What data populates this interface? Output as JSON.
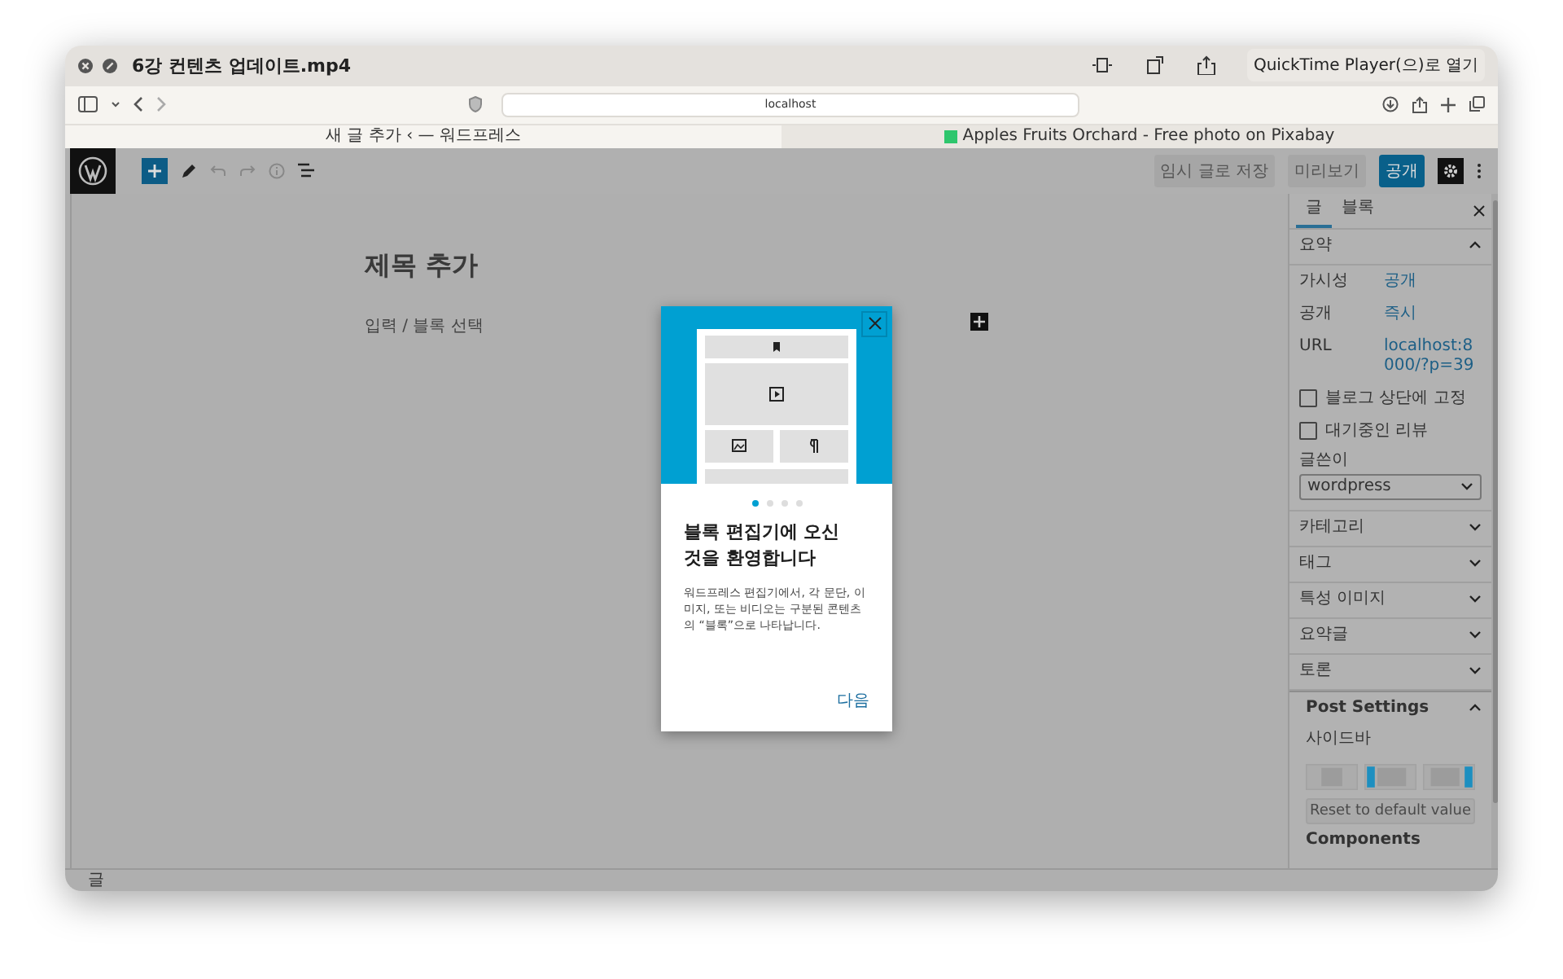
{
  "video_window": {
    "title": "6강 컨텐츠 업데이트.mp4",
    "open_button": "QuickTime Player(으)로 열기"
  },
  "browser": {
    "address": "localhost",
    "tabs": [
      {
        "label": "새 글 추가 ‹ — 워드프레스",
        "selected": true
      },
      {
        "label": "Apples Fruits Orchard - Free photo on Pixabay",
        "selected": false
      }
    ]
  },
  "editor_toolbar": {
    "buttons": [
      {
        "kind": "secondary",
        "label": "임시 글로 저장"
      },
      {
        "kind": "secondary",
        "label": "미리보기"
      },
      {
        "kind": "primary",
        "label": "공개"
      }
    ]
  },
  "editor": {
    "title_placeholder": "제목 추가",
    "block_placeholder": "입력 / 블록 선택"
  },
  "sidebar": {
    "tabs": [
      {
        "label": "글",
        "selected": true
      },
      {
        "label": "블록",
        "selected": false
      }
    ],
    "summary": {
      "title": "요약",
      "expanded": true,
      "fields": [
        {
          "label": "가시성",
          "value": "공개"
        },
        {
          "label": "공개",
          "value": "즉시"
        },
        {
          "label": "URL",
          "value": "localhost:8000/?p=39"
        }
      ],
      "checkboxes": [
        {
          "label": "블로그 상단에 고정",
          "checked": false
        },
        {
          "label": "대기중인 리뷰",
          "checked": false
        }
      ],
      "author": {
        "label": "글쓴이",
        "value": "wordpress"
      }
    },
    "panels": [
      {
        "title": "카테고리",
        "expanded": false
      },
      {
        "title": "태그",
        "expanded": false
      },
      {
        "title": "특성 이미지",
        "expanded": false
      },
      {
        "title": "요약글",
        "expanded": false
      },
      {
        "title": "토론",
        "expanded": false
      }
    ],
    "post_settings": {
      "title": "Post Settings",
      "expanded": true,
      "sidebar_label": "사이드바",
      "layouts": [
        {
          "kind": "none"
        },
        {
          "kind": "left"
        },
        {
          "kind": "right"
        }
      ],
      "reset_button": "Reset to default value",
      "components_label": "Components"
    }
  },
  "modal": {
    "dots": [
      {
        "selected": true
      },
      {
        "selected": false
      },
      {
        "selected": false
      },
      {
        "selected": false
      }
    ],
    "heading": "블록 편집기에 오신 것을 환영합니다",
    "body": "워드프레스 편집기에서, 각 문단, 이미지, 또는 비디오는 구분된 콘텐츠의 “블록”으로 나타납니다.",
    "next_button": "다음"
  },
  "status_bar": {
    "breadcrumb": "글"
  }
}
